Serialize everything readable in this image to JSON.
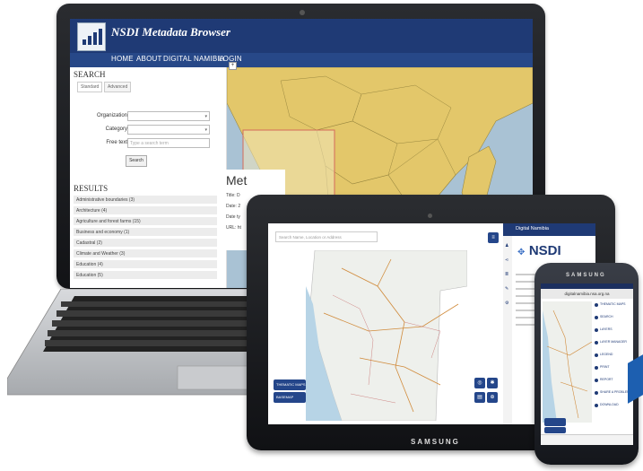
{
  "laptop": {
    "app_title": "NSDI Metadata Browser",
    "nav": [
      "HOME",
      "ABOUT",
      "DIGITAL NAMIBIA",
      "LOGIN"
    ],
    "search_header": "SEARCH",
    "tabs": [
      "Standard",
      "Advanced"
    ],
    "fields": [
      {
        "label": "Organization",
        "value": ""
      },
      {
        "label": "Category",
        "value": ""
      },
      {
        "label": "Free text",
        "value": "Type a search term"
      }
    ],
    "search_button": "Search",
    "results_header": "RESULTS",
    "results": [
      "Administrative boundaries (3)",
      "Architecture (4)",
      "Agriculture and forest farms (15)",
      "Business and economy (1)",
      "Cadastral (2)",
      "Climate and Weather (3)",
      "Education (4)",
      "Education (5)"
    ],
    "metadata_title": "Met",
    "metadata_rows": [
      "Title: D",
      "Date: 2",
      "Date ty",
      "URL: ht"
    ],
    "zoom_label": "+"
  },
  "tablet": {
    "search_placeholder": "Search Name, Location or Address",
    "panel_title": "Digital Namibia",
    "panel_logo_text": "NSDI",
    "buttons": [
      "THEMATIC MAPS",
      "BASEMAP"
    ],
    "brand": "SAMSUNG"
  },
  "phone": {
    "url": "digitalnamibia.nsa.org.na",
    "brand": "SAMSUNG",
    "menu_items": [
      "THEMATIC MAPS",
      "SEARCH",
      "LAYERS",
      "LAYER MANAGER",
      "LEGEND",
      "PRINT",
      "REPORT",
      "SHARE A PROBLEM",
      "DOWNLOAD"
    ]
  },
  "colors": {
    "brand_blue": "#1f3a75",
    "map_land": "#e3c76a",
    "map_water": "#a9c2d4"
  }
}
